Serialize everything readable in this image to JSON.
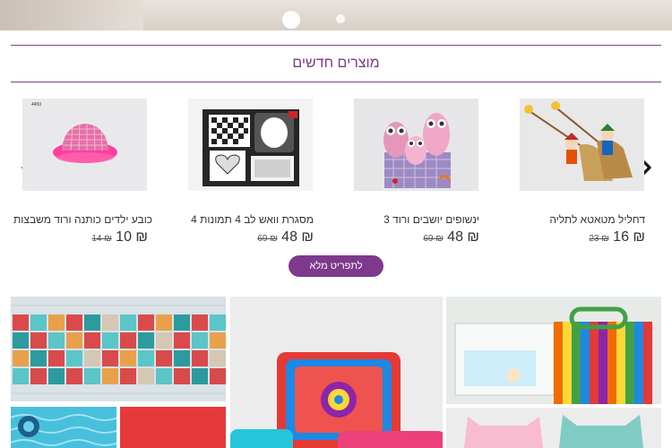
{
  "section": {
    "title": "מוצרים חדשים",
    "menu_button": "לתפריט מלא"
  },
  "carousel": {
    "prev_icon": "chevron-left-icon",
    "next_icon": "chevron-right-icon",
    "products": [
      {
        "name": "כובע ילדים כותנה ורוד משבצות",
        "price": "10 ₪",
        "old_price": "14 ₪",
        "image_label": "4450",
        "image": "pink-checkered-bucket-hat"
      },
      {
        "name": "מסגרת וואש לב 4 תמונות 4",
        "price": "48 ₪",
        "old_price": "69 ₪",
        "image": "black-white-multi-photo-frame"
      },
      {
        "name": "3 ינשופים יושבים ורוד",
        "price": "48 ₪",
        "old_price": "69 ₪",
        "image": "three-pink-owls-figurine"
      },
      {
        "name": "דחליל מטאטא לתליה",
        "price": "16 ₪",
        "old_price": "23 ₪",
        "image": "hanging-broom-scarecrow-dolls"
      }
    ]
  },
  "colors": {
    "accent": "#7d3a8c",
    "title_color": "#7a3b86"
  }
}
